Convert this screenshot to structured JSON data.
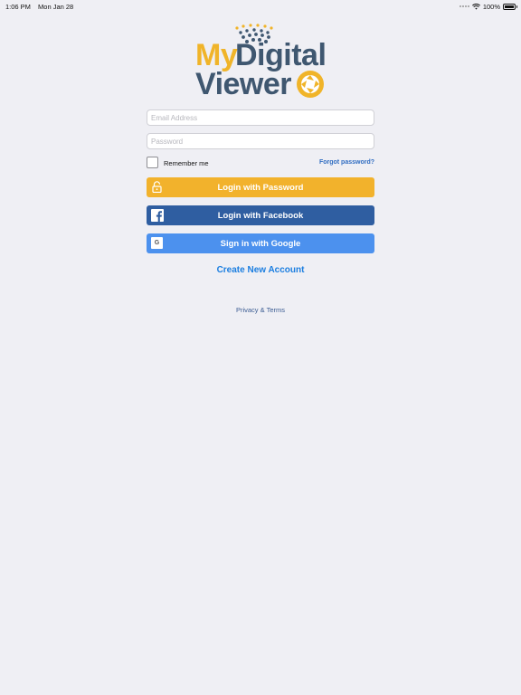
{
  "status_bar": {
    "time": "1:06 PM",
    "date": "Mon Jan 28",
    "battery": "100%"
  },
  "logo": {
    "part1": "My",
    "part2": "Digital",
    "part3": "Viewer"
  },
  "form": {
    "email_placeholder": "Email Address",
    "password_placeholder": "Password",
    "remember_label": "Remember me",
    "forgot_label": "Forgot password?"
  },
  "buttons": {
    "password_login": "Login with Password",
    "facebook_login": "Login with Facebook",
    "google_signin": "Sign in with Google",
    "google_icon_letter": "G"
  },
  "links": {
    "create_account": "Create New Account",
    "privacy_terms": "Privacy & Terms"
  },
  "colors": {
    "brand_yellow": "#f2b22c",
    "brand_navy": "#3f5770",
    "facebook_blue": "#2f5ea1",
    "google_blue": "#4c91ee",
    "link_blue": "#1b7ee0"
  }
}
